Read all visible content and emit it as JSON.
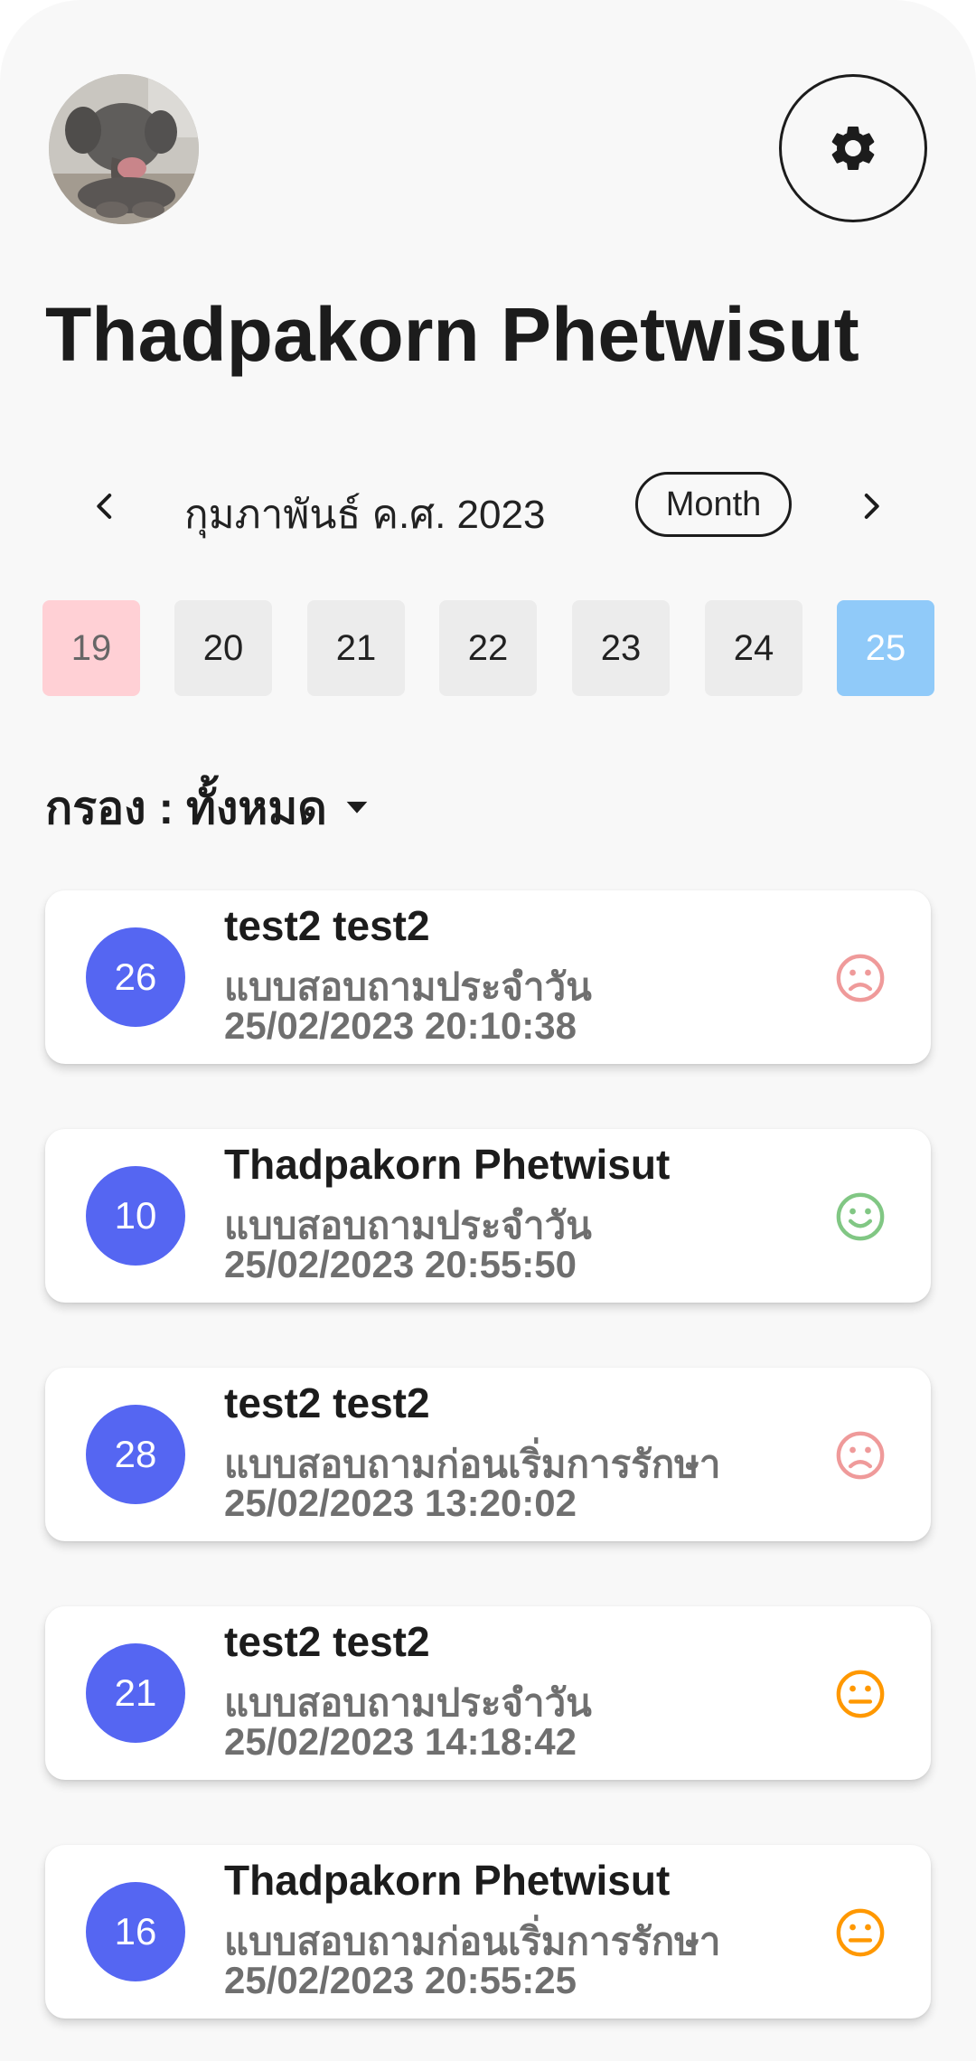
{
  "profile": {
    "name": "Thadpakorn Phetwisut"
  },
  "calendar": {
    "month_label": "กุมภาพันธ์ ค.ศ. 2023",
    "view_toggle": "Month",
    "days": [
      {
        "label": "19",
        "state": "marked"
      },
      {
        "label": "20",
        "state": "normal"
      },
      {
        "label": "21",
        "state": "normal"
      },
      {
        "label": "22",
        "state": "normal"
      },
      {
        "label": "23",
        "state": "normal"
      },
      {
        "label": "24",
        "state": "normal"
      },
      {
        "label": "25",
        "state": "selected"
      }
    ]
  },
  "filter": {
    "label": "กรอง : ทั้งหมด"
  },
  "records": [
    {
      "score": "26",
      "name": "test2 test2",
      "type": "แบบสอบถามประจำวัน",
      "datetime": "25/02/2023 20:10:38",
      "mood": "sad"
    },
    {
      "score": "10",
      "name": "Thadpakorn Phetwisut",
      "type": "แบบสอบถามประจำวัน",
      "datetime": "25/02/2023 20:55:50",
      "mood": "happy"
    },
    {
      "score": "28",
      "name": "test2 test2",
      "type": "แบบสอบถามก่อนเริ่มการรักษา",
      "datetime": "25/02/2023 13:20:02",
      "mood": "sad"
    },
    {
      "score": "21",
      "name": "test2 test2",
      "type": "แบบสอบถามประจำวัน",
      "datetime": "25/02/2023 14:18:42",
      "mood": "neutral"
    },
    {
      "score": "16",
      "name": "Thadpakorn Phetwisut",
      "type": "แบบสอบถามก่อนเริ่มการรักษา",
      "datetime": "25/02/2023 20:55:25",
      "mood": "neutral"
    }
  ],
  "colors": {
    "score_badge": "#5566f2",
    "day_selected": "#90caf9",
    "day_marked": "#ffd0d5",
    "mood_sad": "#ef9a9a",
    "mood_happy": "#81c784",
    "mood_neutral": "#ff9800"
  },
  "icons": {
    "settings": "gear-icon",
    "prev": "chevron-left-icon",
    "next": "chevron-right-icon",
    "filter": "caret-down-icon"
  }
}
